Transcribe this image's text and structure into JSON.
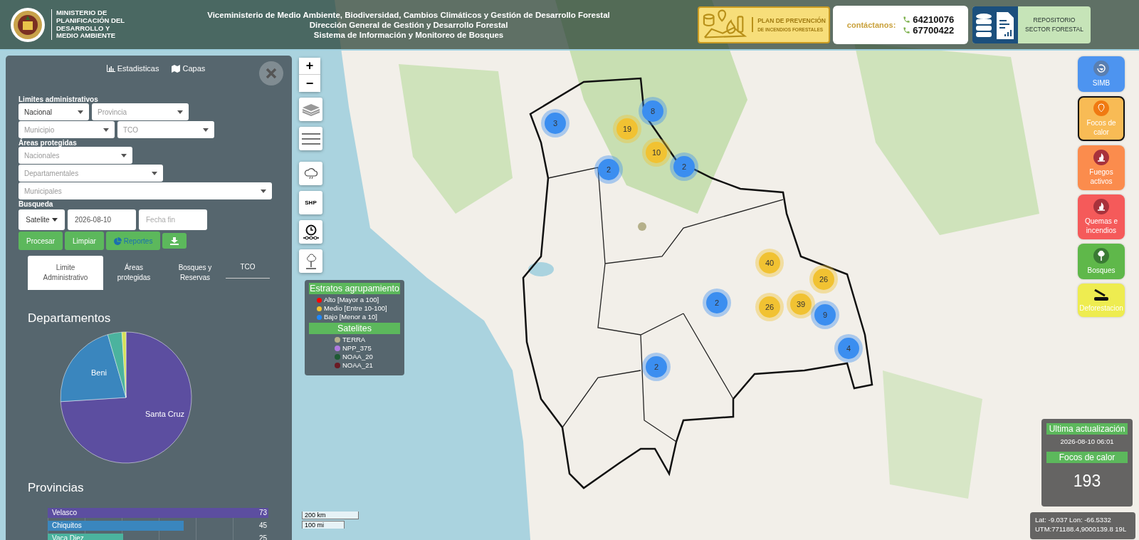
{
  "header": {
    "ministry_lines": [
      "MINISTERIO DE",
      "PLANIFICACIÓN DEL",
      "DESARROLLO Y",
      "MEDIO AMBIENTE"
    ],
    "titles": [
      "Viceministerio de Medio Ambiente, Biodiversidad, Cambios Climáticos y Gestión de Desarrollo Forestal",
      "Dirección General de Gestión y Desarrollo Forestal",
      "Sistema de Información y Monitoreo de Bosques"
    ],
    "plan": {
      "title": "PLAN DE PREVENCIÓN",
      "subtitle": "DE INCENDIOS FORESTALES"
    },
    "contact": {
      "label": "contáctanos:",
      "phones": [
        "64210076",
        "67700422"
      ]
    },
    "repository": {
      "lines": [
        "REPOSITORIO",
        "SECTOR FORESTAL"
      ]
    }
  },
  "panel": {
    "top_links": [
      {
        "kind": "chart",
        "label": "Estadisticas"
      },
      {
        "kind": "map",
        "label": "Capas"
      }
    ],
    "sections": [
      {
        "title": "Limites administrativos",
        "rows": [
          [
            {
              "value": "Nacional"
            },
            {
              "placeholder": "Provincia"
            }
          ],
          [
            {
              "placeholder": "Municipio"
            },
            {
              "placeholder": "TCO"
            }
          ]
        ]
      },
      {
        "title": "Áreas protegidas",
        "rows": [
          [
            {
              "placeholder": "Nacionales"
            }
          ],
          [
            {
              "placeholder": "Departamentales"
            }
          ],
          [
            {
              "placeholder": "Municipales"
            }
          ]
        ]
      }
    ],
    "search": {
      "title": "Busqueda",
      "source": "Satelite",
      "start_date": "2026-08-10",
      "end_placeholder": "Fecha fin"
    },
    "actions": [
      {
        "kind": "text",
        "label": "Procesar"
      },
      {
        "kind": "text",
        "label": "Limpiar"
      },
      {
        "kind": "report",
        "label": "Reportes"
      },
      {
        "kind": "download"
      }
    ],
    "tabs": [
      {
        "label": "Limite Administrativo",
        "selected": true
      },
      {
        "label": "Áreas protegidas",
        "selected": false
      },
      {
        "label": "Bosques y Reservas",
        "selected": false
      },
      {
        "label": "TCO",
        "selected": false
      }
    ],
    "pie": {
      "title": "Departamentos",
      "labels": [
        "Santa Cruz",
        "Beni"
      ]
    },
    "bars": {
      "title": "Provincias",
      "chart_data": {
        "type": "bar",
        "orientation": "horizontal",
        "categories": [
          "Velasco",
          "Chiquitos",
          "Vaca Diez"
        ],
        "values": [
          73,
          45,
          25
        ],
        "data_labels": true
      }
    }
  },
  "map_controls": {
    "zoom_in": "+",
    "zoom_out": "−",
    "shp": "SHP"
  },
  "legend": {
    "strata_title": "Estratos agrupamiento",
    "strata": [
      {
        "label": "Alto [Mayor a 100]",
        "color": "#ff0000"
      },
      {
        "label": "Medio [Entre 10-100]",
        "color": "#f1c232"
      },
      {
        "label": "Bajo [Menor a 10]",
        "color": "#1e88ff"
      }
    ],
    "satellites_title": "Satelites",
    "satellites": [
      {
        "label": "TERRA",
        "color": "#b5b08a"
      },
      {
        "label": "NPP_375",
        "color": "#b07ae0"
      },
      {
        "label": "NOAA_20",
        "color": "#1f5a34"
      },
      {
        "label": "NOAA_21",
        "color": "#6a1a24"
      }
    ]
  },
  "clusters": [
    {
      "count": "3",
      "color": "#3b8ef0"
    },
    {
      "count": "19",
      "color": "#f1c232"
    },
    {
      "count": "8",
      "color": "#3b8ef0"
    },
    {
      "count": "10",
      "color": "#f1c232"
    },
    {
      "count": "2",
      "color": "#3b8ef0"
    },
    {
      "count": "2",
      "color": "#3b8ef0"
    },
    {
      "count": "40",
      "color": "#f1c232"
    },
    {
      "count": "26",
      "color": "#f1c232"
    },
    {
      "count": "2",
      "color": "#3b8ef0"
    },
    {
      "count": "26",
      "color": "#f1c232"
    },
    {
      "count": "39",
      "color": "#f1c232"
    },
    {
      "count": "9",
      "color": "#3b8ef0"
    },
    {
      "count": "4",
      "color": "#3b8ef0"
    },
    {
      "count": "2",
      "color": "#3b8ef0"
    }
  ],
  "points": [
    {
      "color": "#b5b08a"
    }
  ],
  "layers": [
    {
      "kind": "simb",
      "label": "SIMB",
      "color": "#4d94f0",
      "selected": false
    },
    {
      "kind": "heat",
      "label": "Focos de calor",
      "color": "#f8bb55",
      "selected": true
    },
    {
      "kind": "fire",
      "label": "Fuegos activos",
      "color": "#fb8c4d",
      "selected": false
    },
    {
      "kind": "fire",
      "label": "Quemas e incendios",
      "color": "#f55a5a",
      "selected": false
    },
    {
      "kind": "tree",
      "label": "Bosques",
      "color": "#5fb84a",
      "selected": false
    },
    {
      "kind": "axe",
      "label": "Deforestacion",
      "color": "#eeec50",
      "selected": false
    }
  ],
  "info": {
    "update_title": "Ultima actualización",
    "update_time": "2026-08-10 06:01",
    "count_title": "Focos de calor",
    "count": "193"
  },
  "coordinates": [
    "Lat: -9.037 Lon: -66.5332",
    "UTM:771188.4,9000139.8 19L"
  ],
  "scale": [
    "200 km",
    "100 mi"
  ]
}
